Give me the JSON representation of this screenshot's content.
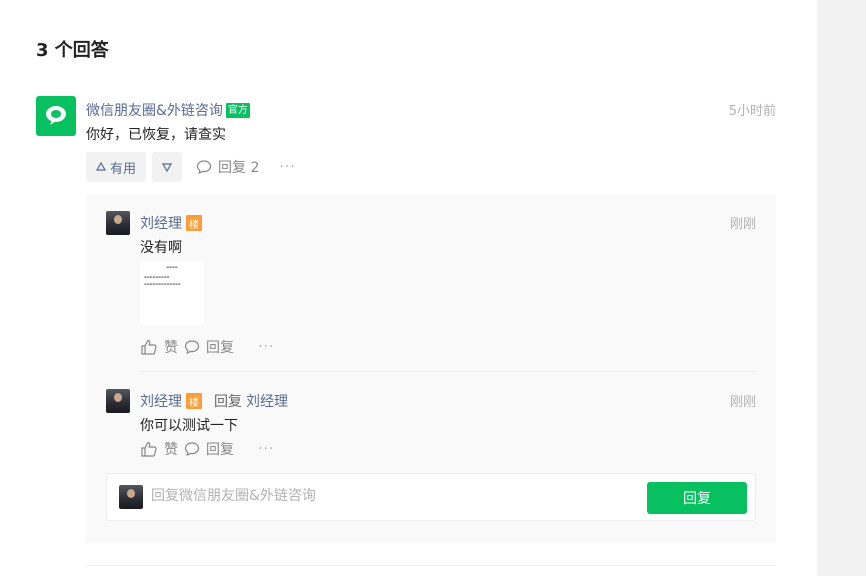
{
  "page": {
    "title": "3 个回答"
  },
  "answer": {
    "author": "微信朋友圈&外链咨询",
    "badge": "官方",
    "time": "5小时前",
    "body": "你好，已恢复，请查实",
    "useful_label": "有用",
    "reply_label": "回复 2",
    "more": "···",
    "logo_icon": "wechat-chat-bubble-icon",
    "accent": "#07c160"
  },
  "comments": [
    {
      "name": "刘经理",
      "floor": "楼",
      "time": "刚刚",
      "text": "没有啊",
      "like_label": "赞",
      "reply_label": "回复",
      "more": "···"
    },
    {
      "name": "刘经理",
      "floor": "楼",
      "reply_word": "回复",
      "reply_to": "刘经理",
      "time": "刚刚",
      "text": "你可以测试一下",
      "like_label": "赞",
      "reply_label": "回复",
      "more": "···"
    }
  ],
  "reply_box": {
    "placeholder": "回复微信朋友圈&外链咨询",
    "submit_label": "回复"
  },
  "colors": {
    "brand_green": "#07c160",
    "link_blue": "#576b95",
    "floor_orange": "#fa9d3b"
  }
}
